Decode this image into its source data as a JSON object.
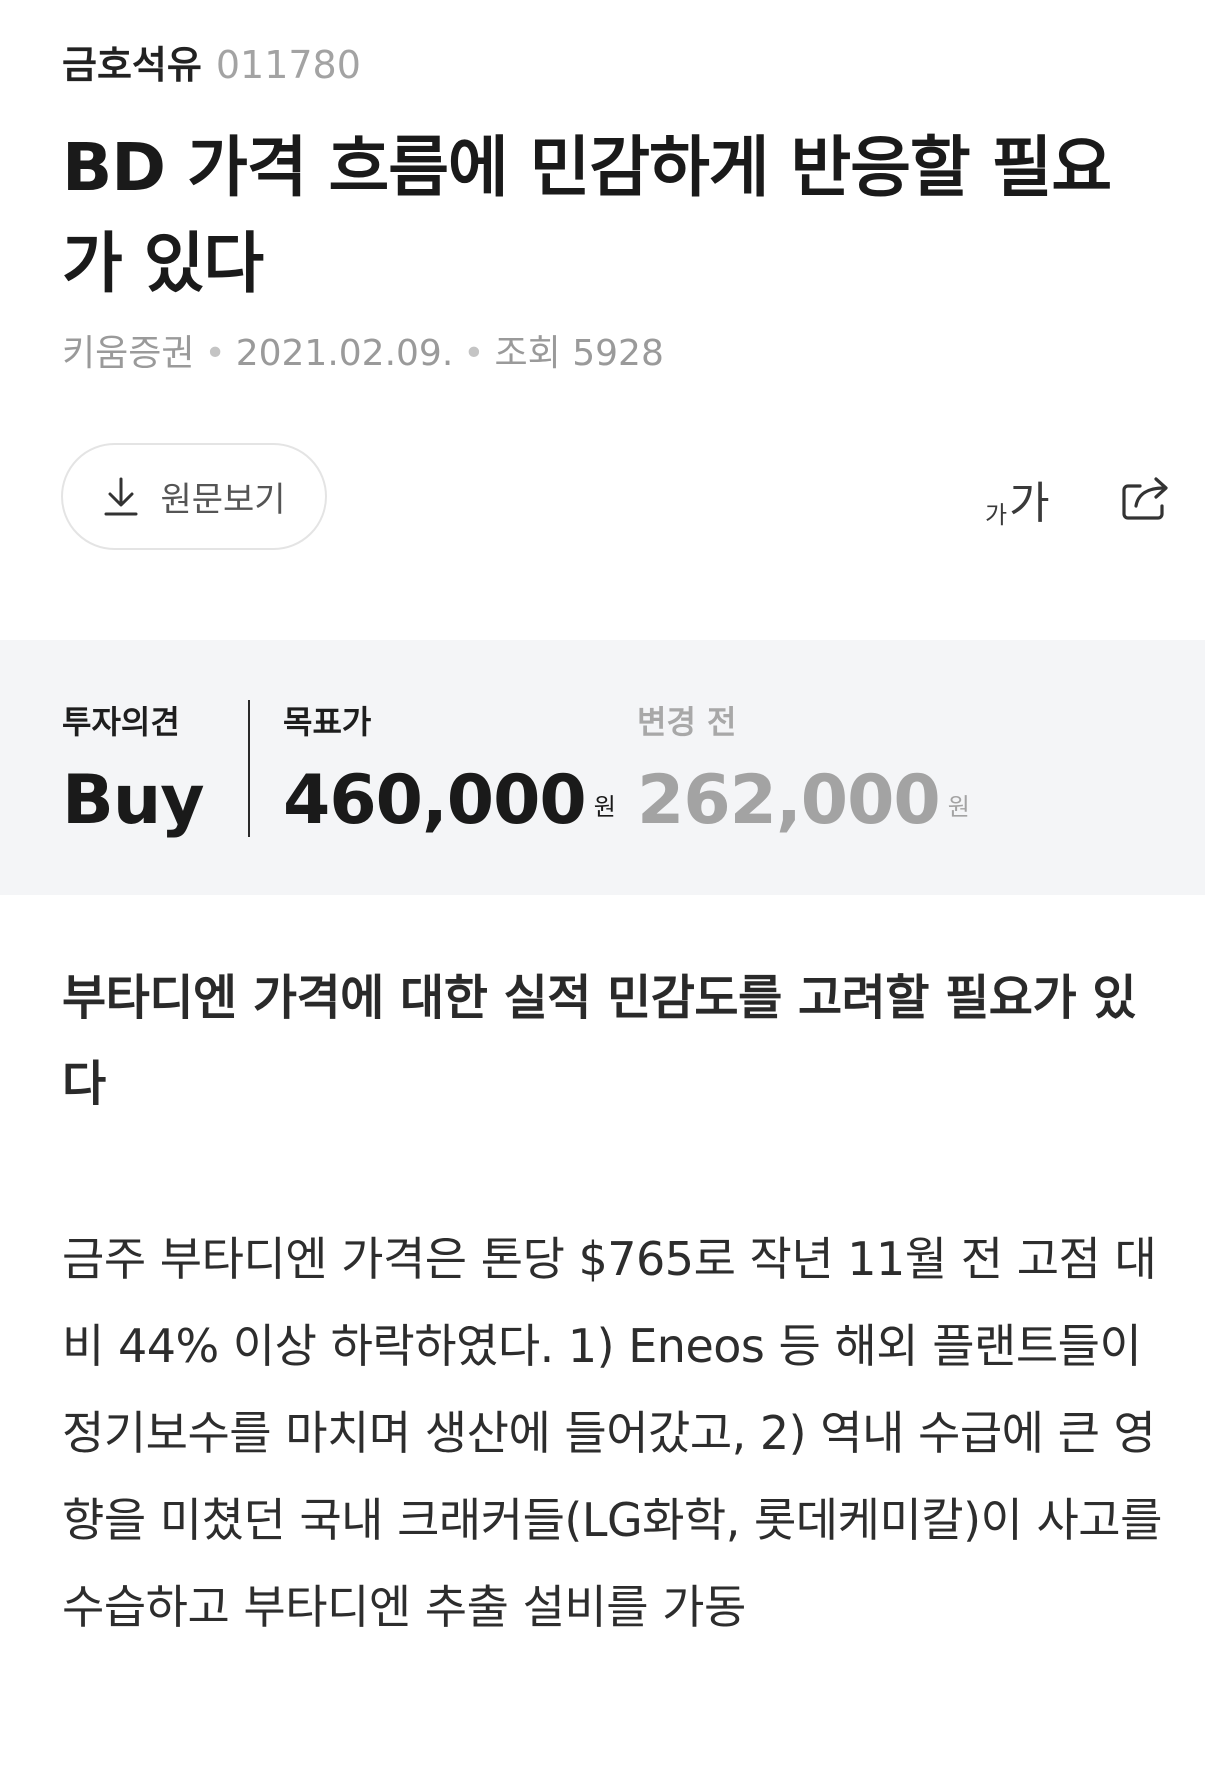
{
  "stock": {
    "name": "금호석유",
    "code": "011780"
  },
  "report": {
    "title": "BD 가격 흐름에 민감하게 반응할 필요가 있다",
    "broker": "키움증권",
    "date": "2021.02.09.",
    "views_label": "조회",
    "views_count": "5928"
  },
  "actions": {
    "original_label": "원문보기",
    "font_small": "가",
    "font_big": "가",
    "download_icon": "download-icon",
    "share_icon": "share-icon"
  },
  "opinion": {
    "opinion_label": "투자의견",
    "opinion_value": "Buy",
    "target_label": "목표가",
    "target_value": "460,000",
    "target_unit": "원",
    "prev_label": "변경 전",
    "prev_value": "262,000",
    "prev_unit": "원"
  },
  "content": {
    "section_title": "부타디엔 가격에 대한 실적 민감도를 고려할 필요가 있다",
    "paragraph": "금주 부타디엔 가격은 톤당 $765로 작년 11월 전 고점 대비 44% 이상 하락하였다. 1) Eneos 등 해외 플랜트들이 정기보수를 마치며 생산에 들어갔고, 2) 역내 수급에 큰 영향을 미쳤던 국내 크래커들(LG화학, 롯데케미칼)이 사고를 수습하고 부타디엔 추출 설비를 가동"
  }
}
